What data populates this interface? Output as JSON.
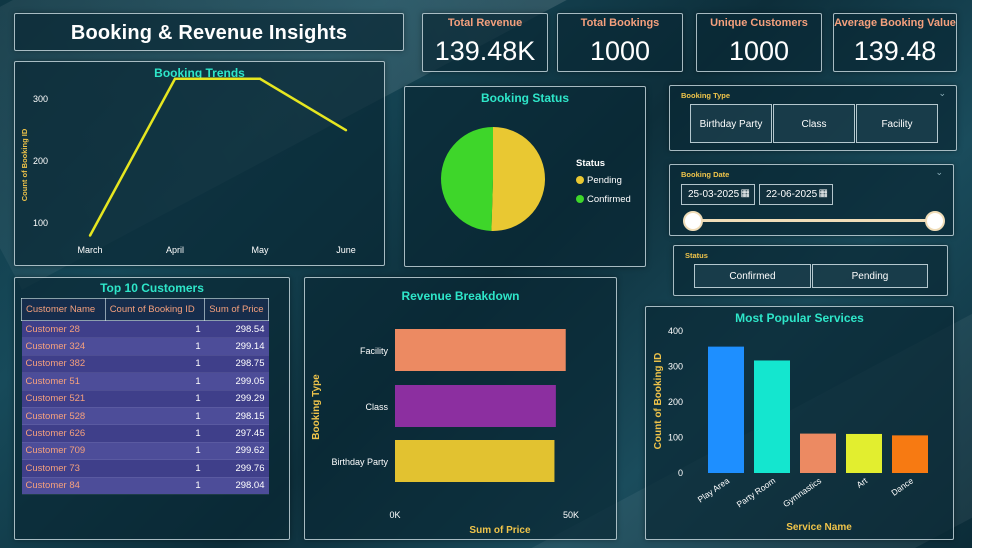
{
  "header": {
    "title": "Booking & Revenue Insights"
  },
  "kpis": [
    {
      "label": "Total Revenue",
      "value": "139.48K"
    },
    {
      "label": "Total Bookings",
      "value": "1000"
    },
    {
      "label": "Unique Customers",
      "value": "1000"
    },
    {
      "label": "Average Booking Value",
      "value": "139.48"
    }
  ],
  "booking_type_slicer": {
    "title": "Booking Type",
    "options": [
      "Birthday Party",
      "Class",
      "Facility"
    ]
  },
  "booking_date_slicer": {
    "title": "Booking Date",
    "start": "25-03-2025",
    "end": "22-06-2025"
  },
  "status_slicer": {
    "title": "Status",
    "options": [
      "Confirmed",
      "Pending"
    ]
  },
  "booking_trends": {
    "title": "Booking Trends",
    "chart_data": {
      "type": "line",
      "title": "Booking Trends",
      "ylabel": "Count of Booking ID",
      "xlabel": "",
      "categories": [
        "March",
        "April",
        "May",
        "June"
      ],
      "values": [
        80,
        333,
        333,
        250
      ],
      "yticks": [
        "100",
        "200",
        "300"
      ],
      "ylim": [
        60,
        360
      ],
      "color": "#e6e620"
    }
  },
  "booking_status": {
    "title": "Booking Status",
    "chart_data": {
      "type": "pie",
      "title": "Booking Status",
      "legend_title": "Status",
      "slices": [
        {
          "label": "Pending",
          "value": 50.5,
          "color": "#e9c832"
        },
        {
          "label": "Confirmed",
          "value": 49.5,
          "color": "#3ed62a"
        }
      ]
    }
  },
  "top_customers": {
    "title": "Top 10 Customers",
    "columns": [
      "Customer Name",
      "Count of Booking ID",
      "Sum of Price"
    ],
    "rows": [
      [
        "Customer 28",
        "1",
        "298.54"
      ],
      [
        "Customer 324",
        "1",
        "299.14"
      ],
      [
        "Customer 382",
        "1",
        "298.75"
      ],
      [
        "Customer 51",
        "1",
        "299.05"
      ],
      [
        "Customer 521",
        "1",
        "299.29"
      ],
      [
        "Customer 528",
        "1",
        "298.15"
      ],
      [
        "Customer 626",
        "1",
        "297.45"
      ],
      [
        "Customer 709",
        "1",
        "299.62"
      ],
      [
        "Customer 73",
        "1",
        "299.76"
      ],
      [
        "Customer 84",
        "1",
        "298.04"
      ]
    ]
  },
  "revenue_breakdown": {
    "title": "Revenue Breakdown",
    "chart_data": {
      "type": "bar",
      "orientation": "horizontal",
      "title": "Revenue Breakdown",
      "xlabel": "Sum of Price",
      "ylabel": "Booking Type",
      "categories": [
        "Facility",
        "Class",
        "Birthday Party"
      ],
      "values": [
        48500,
        45700,
        45300
      ],
      "colors": [
        "#ec8a62",
        "#8c2fa0",
        "#e2c230"
      ],
      "xticks": [
        "0K",
        "50K"
      ],
      "xlim": [
        0,
        50000
      ]
    }
  },
  "popular_services": {
    "title": "Most Popular Services",
    "chart_data": {
      "type": "bar",
      "title": "Most Popular Services",
      "xlabel": "Service Name",
      "ylabel": "Count of Booking ID",
      "categories": [
        "Play Area",
        "Party Room",
        "Gymnastics",
        "Art",
        "Dance"
      ],
      "values": [
        356,
        317,
        111,
        110,
        106
      ],
      "colors": [
        "#1e8fff",
        "#14e6cf",
        "#ec8a62",
        "#e2ee2f",
        "#f77a12"
      ],
      "yticks": [
        "0",
        "100",
        "200",
        "300",
        "400"
      ],
      "ylim": [
        0,
        400
      ]
    }
  }
}
